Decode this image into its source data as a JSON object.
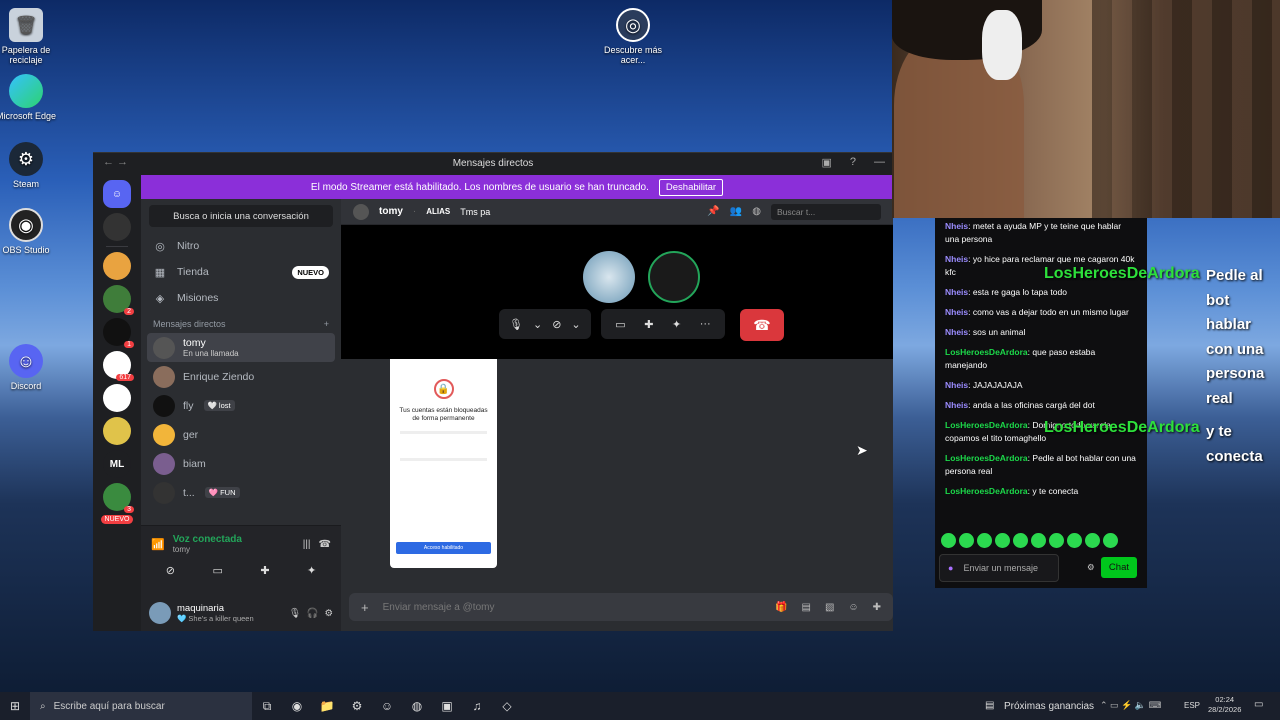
{
  "desktop": {
    "icons": [
      {
        "label": "Papelera de reciclaje",
        "icon": "recycle-bin-icon"
      },
      {
        "label": "Microsoft Edge",
        "icon": "edge-icon"
      },
      {
        "label": "Steam",
        "icon": "steam-icon"
      },
      {
        "label": "OBS Studio",
        "icon": "obs-icon"
      },
      {
        "label": "Discord",
        "icon": "discord-icon"
      },
      {
        "label": "Descubre más acer...",
        "icon": "acer-icon"
      }
    ]
  },
  "discord": {
    "window_title": "Mensajes directos",
    "banner": {
      "text": "El modo Streamer está habilitado. Los nombres de usuario se han truncado.",
      "button": "Deshabilitar"
    },
    "server_badges": [
      "2",
      "1",
      "617",
      "3"
    ],
    "server_ml": "ML",
    "server_new": "NUEVO",
    "search_placeholder": "Busca o inicia una conversación",
    "nav": [
      {
        "label": "Nitro",
        "icon": "nitro-icon"
      },
      {
        "label": "Tienda",
        "icon": "shop-icon",
        "pill": "NUEVO"
      },
      {
        "label": "Misiones",
        "icon": "quests-icon"
      }
    ],
    "dm_header": "Mensajes directos",
    "dms": [
      {
        "name": "tomy",
        "sub": "En una llamada",
        "active": true,
        "color": "#555"
      },
      {
        "name": "Enrique Ziendo",
        "color": "#8a6d5c"
      },
      {
        "name": "fly",
        "tag": "🤍 lost",
        "color": "#111"
      },
      {
        "name": "ger",
        "color": "#f2b53a"
      },
      {
        "name": "biam",
        "color": "#7a5e8f"
      },
      {
        "name": "t...",
        "tag": "🩷 FUN",
        "color": "#333"
      }
    ],
    "voice": {
      "status": "Voz conectada",
      "channel": "tomy"
    },
    "user": {
      "name": "maquinaria",
      "status": "🩵 She's a killer queen"
    },
    "channel": {
      "name": "tomy",
      "alias_label": "ALIAS",
      "alias_value": "Tms pa",
      "search": "Buscar t..."
    },
    "phone_screen": {
      "title": "Tus cuentas están bloqueadas de forma permanente",
      "button": "Acceso habilitado"
    },
    "message_placeholder": "Enviar mensaje a @tomy"
  },
  "twitch_chat": {
    "messages": [
      {
        "user": "Nheis",
        "text": "metet a ayuda MP y te teine que hablar una persona",
        "mod": false
      },
      {
        "user": "Nheis",
        "text": "yo hice para reclamar que me cagaron 40k kfc",
        "mod": false
      },
      {
        "user": "Nheis",
        "text": "esta re gaga lo tapa todo",
        "mod": false
      },
      {
        "user": "Nheis",
        "text": "como vas a dejar todo en un mismo lugar",
        "mod": false
      },
      {
        "user": "Nheis",
        "text": "sos un animal",
        "mod": false
      },
      {
        "user": "LosHeroesDeArdora",
        "text": "que paso estaba manejando",
        "mod": true
      },
      {
        "user": "Nheis",
        "text": "JAJAJAJAJA",
        "mod": false
      },
      {
        "user": "Nheis",
        "text": "anda a las oficinas cargá del dot",
        "mod": false
      },
      {
        "user": "LosHeroesDeArdora",
        "text": "Domigno todo varela copamos el tito tomaghello",
        "mod": true
      },
      {
        "user": "LosHeroesDeArdora",
        "text": "Pedle al bot hablar con una persona real",
        "mod": true
      },
      {
        "user": "LosHeroesDeArdora",
        "text": "y te conecta",
        "mod": true
      }
    ],
    "input_placeholder": "Enviar un mensaje",
    "chat_button": "Chat"
  },
  "overlay": {
    "name": "LosHeroesDeArdora",
    "line1": "Pedle al bot hablar con una persona real",
    "line2": "y te conecta"
  },
  "taskbar": {
    "search": "Escribe aquí para buscar",
    "weather": "Próximas ganancias",
    "lang": "ESP",
    "time": "02:24",
    "date": "28/2/2026"
  }
}
